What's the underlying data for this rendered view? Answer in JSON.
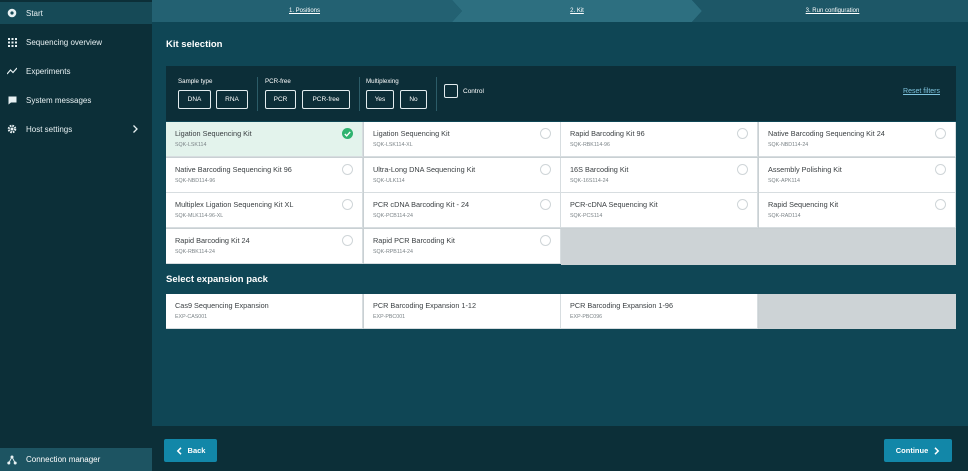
{
  "sidebar": {
    "items": [
      {
        "label": "Start",
        "icon": "start-icon"
      },
      {
        "label": "Sequencing overview",
        "icon": "grid-icon"
      },
      {
        "label": "Experiments",
        "icon": "trend-line-icon"
      },
      {
        "label": "System messages",
        "icon": "message-icon"
      },
      {
        "label": "Host settings",
        "icon": "gear-icon"
      }
    ],
    "bottom_label": "Connection manager"
  },
  "stepper": {
    "steps": [
      "1. Positions",
      "2. Kit",
      "3. Run configuration"
    ]
  },
  "kit_selection": {
    "title": "Kit selection",
    "filters": {
      "sample_type": {
        "label": "Sample type",
        "options": [
          "DNA",
          "RNA"
        ]
      },
      "pcr_free": {
        "label": "PCR-free",
        "options": [
          "PCR",
          "PCR-free"
        ]
      },
      "multiplexing": {
        "label": "Multiplexing",
        "options": [
          "Yes",
          "No"
        ]
      },
      "control_label": "Control",
      "reset_label": "Reset filters"
    },
    "kits": [
      {
        "name": "Ligation Sequencing Kit",
        "code": "SQK-LSK114",
        "selected": true
      },
      {
        "name": "Ligation Sequencing Kit",
        "code": "SQK-LSK114-XL",
        "selected": false
      },
      {
        "name": "Rapid Barcoding Kit 96",
        "code": "SQK-RBK114-96",
        "selected": false
      },
      {
        "name": "Native Barcoding Sequencing Kit 24",
        "code": "SQK-NBD114-24",
        "selected": false
      },
      {
        "name": "Native Barcoding Sequencing Kit 96",
        "code": "SQK-NBD114-96",
        "selected": false
      },
      {
        "name": "Ultra-Long DNA Sequencing Kit",
        "code": "SQK-ULK114",
        "selected": false
      },
      {
        "name": "16S Barcoding Kit",
        "code": "SQK-16S114-24",
        "selected": false
      },
      {
        "name": "Assembly Polishing Kit",
        "code": "SQK-APK114",
        "selected": false
      },
      {
        "name": "Multiplex Ligation Sequencing Kit XL",
        "code": "SQK-MLK114-96-XL",
        "selected": false
      },
      {
        "name": "PCR cDNA Barcoding Kit - 24",
        "code": "SQK-PCB114-24",
        "selected": false
      },
      {
        "name": "PCR-cDNA Sequencing Kit",
        "code": "SQK-PCS114",
        "selected": false
      },
      {
        "name": "Rapid Sequencing Kit",
        "code": "SQK-RAD114",
        "selected": false
      },
      {
        "name": "Rapid Barcoding Kit 24",
        "code": "SQK-RBK114-24",
        "selected": false
      },
      {
        "name": "Rapid PCR Barcoding Kit",
        "code": "SQK-RPB114-24",
        "selected": false
      }
    ]
  },
  "expansion": {
    "title": "Select expansion pack",
    "packs": [
      {
        "name": "Cas9 Sequencing Expansion",
        "code": "EXP-CAS001"
      },
      {
        "name": "PCR Barcoding Expansion 1-12",
        "code": "EXP-PBC001"
      },
      {
        "name": "PCR Barcoding Expansion 1-96",
        "code": "EXP-PBC096"
      }
    ]
  },
  "footer": {
    "back_label": "Back",
    "continue_label": "Continue"
  },
  "colors": {
    "accent": "#1287a8",
    "selected": "#2fb36f",
    "sidebar": "#0c2f38",
    "background": "#0f4655"
  }
}
